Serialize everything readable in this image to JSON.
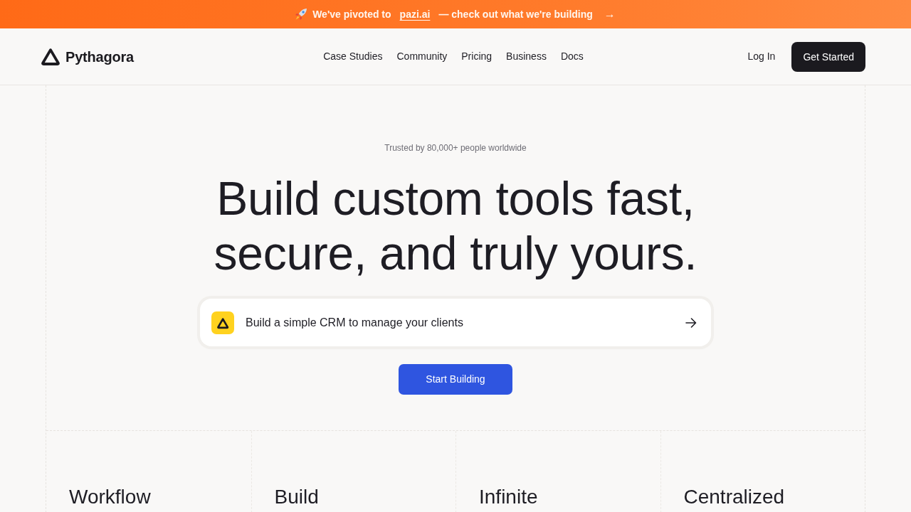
{
  "announcement": {
    "prefix": "We've pivoted to",
    "link": "pazi.ai",
    "suffix": "— check out what we're building",
    "arrow": "→"
  },
  "navbar": {
    "brand": "Pythagora",
    "links": [
      "Case Studies",
      "Community",
      "Pricing",
      "Business",
      "Docs"
    ],
    "login": "Log In",
    "cta": "Get Started"
  },
  "hero": {
    "tagline": "Trusted by 80,000+ people worldwide",
    "headline": "Build custom tools fast, secure, and truly yours.",
    "prompt": {
      "value": "Build a simple CRM to manage your clients"
    },
    "button": "Start Building"
  },
  "features": [
    {
      "title": "Workflow"
    },
    {
      "title": "Build"
    },
    {
      "title": "Infinite"
    },
    {
      "title": "Centralized"
    }
  ]
}
